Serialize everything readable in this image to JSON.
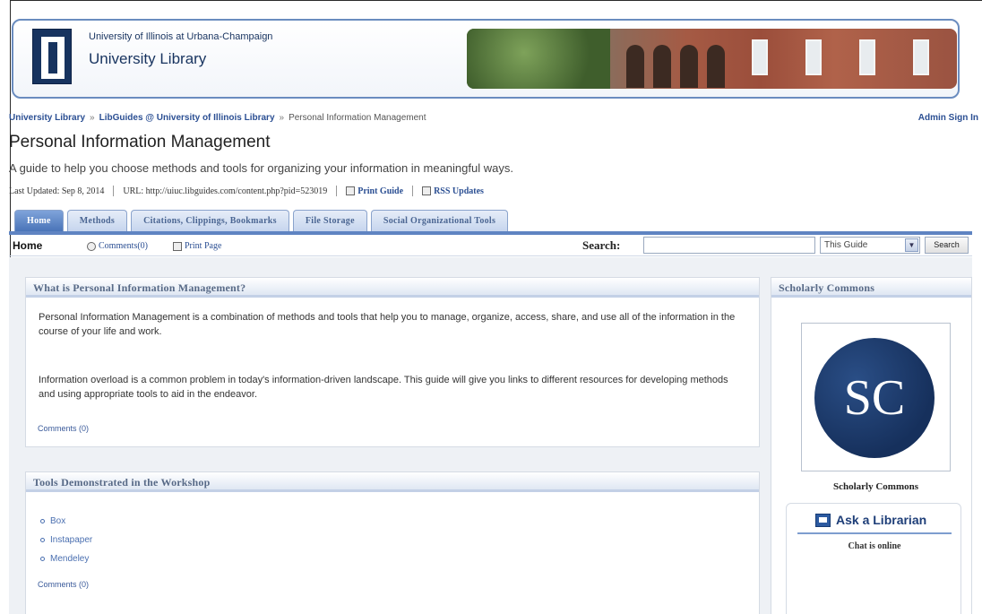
{
  "header": {
    "university": "University of Illinois at Urbana-Champaign",
    "library": "University Library"
  },
  "breadcrumb": {
    "items": [
      "University Library",
      "LibGuides @ University of Illinois Library"
    ],
    "separator": "»",
    "current": "Personal Information Management",
    "admin": "Admin Sign In"
  },
  "page": {
    "title": "Personal Information Management",
    "description": "A guide to help you choose methods and tools for organizing your information in meaningful ways."
  },
  "meta": {
    "updated": "Last Updated: Sep 8, 2014",
    "url": "URL: http://uiuc.libguides.com/content.php?pid=523019",
    "print_guide": "Print Guide",
    "rss": "RSS Updates"
  },
  "tabs": [
    "Home",
    "Methods",
    "Citations, Clippings, Bookmarks",
    "File Storage",
    "Social Organizational Tools"
  ],
  "toolbar": {
    "home": "Home",
    "comments": "Comments(0)",
    "print_page": "Print Page",
    "search_label": "Search:",
    "scope_value": "This Guide",
    "search_button": "Search"
  },
  "what_box": {
    "title": "What is Personal Information Management?",
    "p1": "Personal Information Management is a combination of methods and tools that help you to manage, organize, access, share, and use all of the information in the course of your life and work.",
    "p2": "Information overload is a common problem in today's information-driven landscape. This guide will give you links to different resources for developing methods and using appropriate tools to aid in the endeavor.",
    "comments": "Comments (0)"
  },
  "tools_box": {
    "title": "Tools Demonstrated in the Workshop",
    "items": [
      "Box",
      "Instapaper",
      "Mendeley"
    ],
    "comments": "Comments (0)"
  },
  "sidebar": {
    "title": "Scholarly Commons",
    "logo_text": "SC",
    "logo_caption": "Scholarly Commons",
    "ask_title": "Ask a Librarian",
    "chat_status": "Chat is online"
  },
  "colors": {
    "brand_navy": "#17335f",
    "tab_active": "#4a74b8",
    "link": "#2b4f93"
  }
}
